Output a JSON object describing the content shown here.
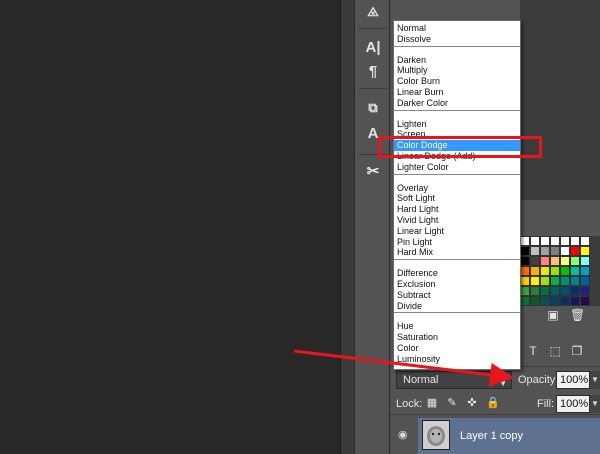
{
  "blend_menu": {
    "groups": [
      [
        "Normal",
        "Dissolve"
      ],
      [
        "Darken",
        "Multiply",
        "Color Burn",
        "Linear Burn",
        "Darker Color"
      ],
      [
        "Lighten",
        "Screen",
        "Color Dodge",
        "Linear Dodge (Add)",
        "Lighter Color"
      ],
      [
        "Overlay",
        "Soft Light",
        "Hard Light",
        "Vivid Light",
        "Linear Light",
        "Pin Light",
        "Hard Mix"
      ],
      [
        "Difference",
        "Exclusion",
        "Subtract",
        "Divide"
      ],
      [
        "Hue",
        "Saturation",
        "Color",
        "Luminosity"
      ]
    ],
    "selected": "Color Dodge"
  },
  "layers_panel": {
    "blend_mode_value": "Normal",
    "opacity_label": "Opacity:",
    "opacity_value": "100%",
    "lock_label": "Lock:",
    "fill_label": "Fill:",
    "fill_value": "100%",
    "layer_name": "Layer 1 copy"
  },
  "colors": {
    "accent_highlight": "#e8161c",
    "selection_blue": "#3399ff",
    "layer_selected": "#5e7191",
    "annotation_arrow": "#e8161c"
  },
  "icons": {
    "tools": [
      "paragraph-styles-icon",
      "character-icon",
      "paragraph-icon",
      "clone-source-icon",
      "type-tool-icon",
      "tool-presets-icon"
    ],
    "layer_filters": [
      "type-filter-icon",
      "shape-filter-icon",
      "smart-object-filter-icon"
    ],
    "lock": [
      "lock-transparent-icon",
      "lock-image-icon",
      "lock-position-icon",
      "lock-all-icon"
    ],
    "visibility": "eye-icon"
  }
}
